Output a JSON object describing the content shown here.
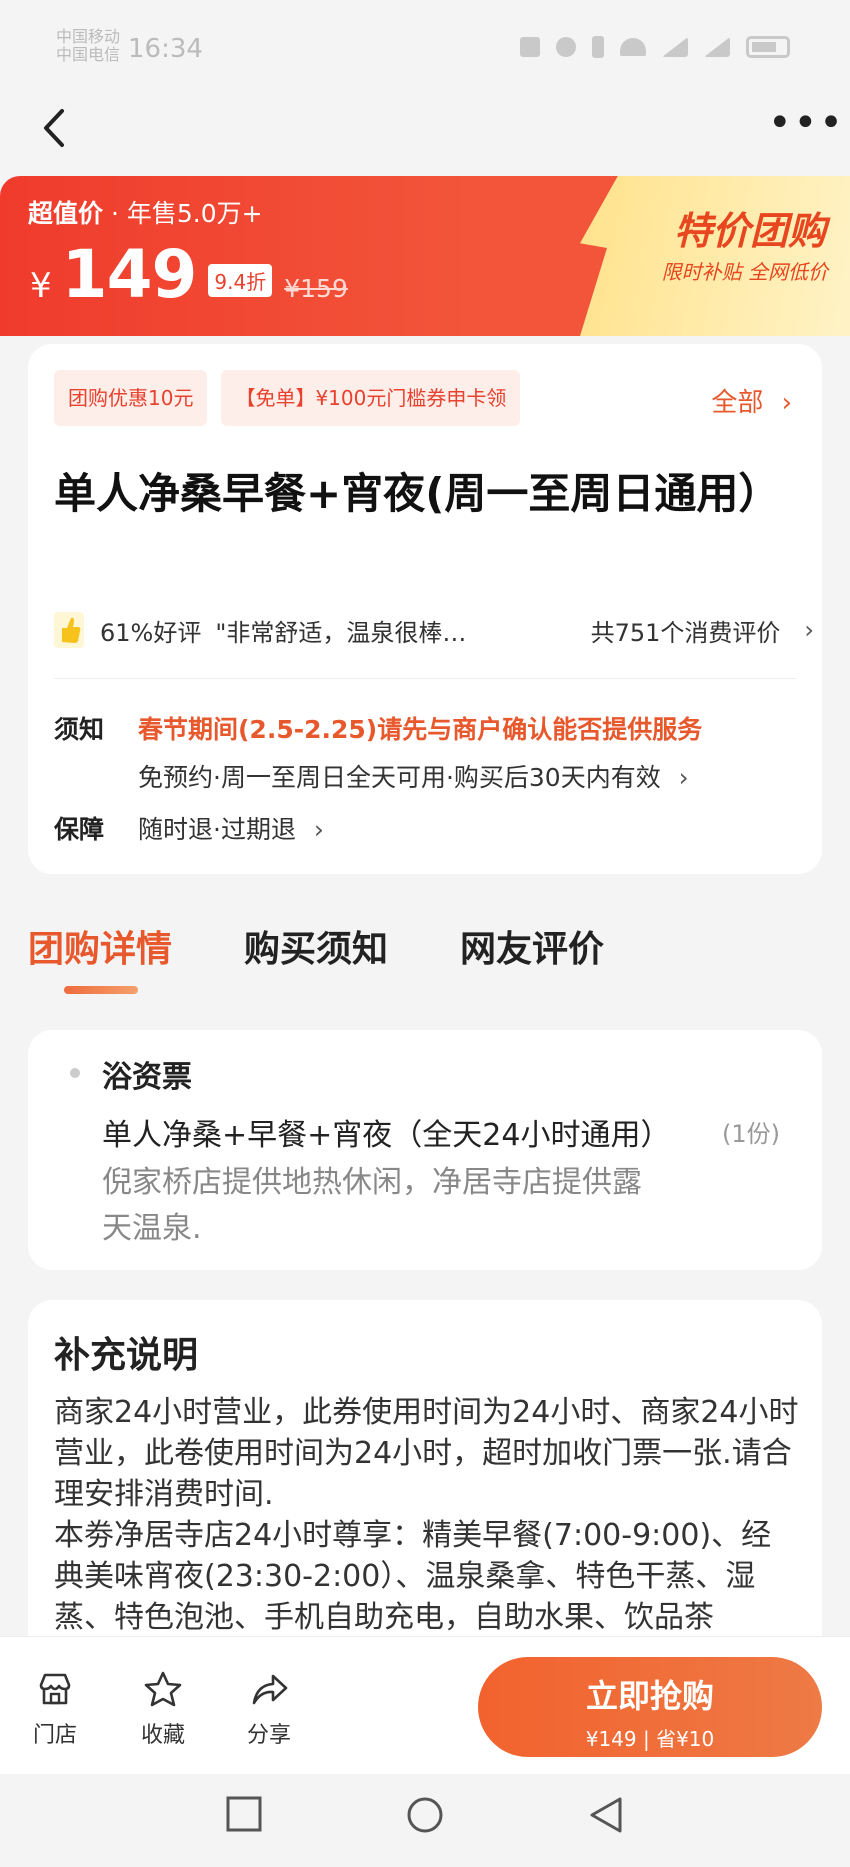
{
  "status_bar": {
    "carrier_1": "中国移动",
    "carrier_2": "中国电信",
    "time": "16:34"
  },
  "banner": {
    "label_bold": "超值价",
    "label_rest": " · 年售5.0万+",
    "currency": "¥",
    "price": "149",
    "discount": "9.4折",
    "original_price": "¥159",
    "promo_title": "特价团购",
    "promo_subtitle": "限时补贴 全网低价"
  },
  "deal": {
    "tags": [
      "团购优惠10元",
      "【免单】¥100元门槛券申卡领"
    ],
    "all_link": "全部",
    "title": "单人净桑早餐+宵夜(周一至周日通用）",
    "rating_percent": "61%好评",
    "rating_quote": "\"非常舒适，温泉很棒…",
    "review_count": "共751个消费评价",
    "notice_label": "须知",
    "notice_alert": "春节期间(2.5-2.25)请先与商户确认能否提供服务",
    "notice_detail": "免预约·周一至周日全天可用·购买后30天内有效",
    "guarantee_label": "保障",
    "guarantee_value": "随时退·过期退"
  },
  "tabs": [
    {
      "label": "团购详情",
      "active": true
    },
    {
      "label": "购买须知",
      "active": false
    },
    {
      "label": "网友评价",
      "active": false
    }
  ],
  "items": {
    "heading": "浴资票",
    "name": "单人净桑+早餐+宵夜（全天24小时通用）",
    "quantity": "(1份)",
    "description": "倪家桥店提供地热休闲，净居寺店提供露天温泉."
  },
  "extra": {
    "title": "补充说明",
    "body": "商家24小时营业，此券使用时间为24小时、商家24小时营业，此卷使用时间为24小时，超时加收门票一张.请合理安排消费时间.\n本劵净居寺店24小时尊享：精美早餐(7:00-9:00)、经典美味宵夜(23:30-2:00）、温泉桑拿、特色干蒸、湿蒸、特色泡池、手机自助充电，自助水果、饮品茶"
  },
  "bottom_bar": {
    "store": "门店",
    "favorite": "收藏",
    "share": "分享",
    "buy_label": "立即抢购",
    "buy_sub": "¥149 | 省¥10"
  },
  "colors": {
    "accent": "#e8582d",
    "banner_red": "#f03b2c",
    "promo_yellow": "#ffe28c"
  }
}
